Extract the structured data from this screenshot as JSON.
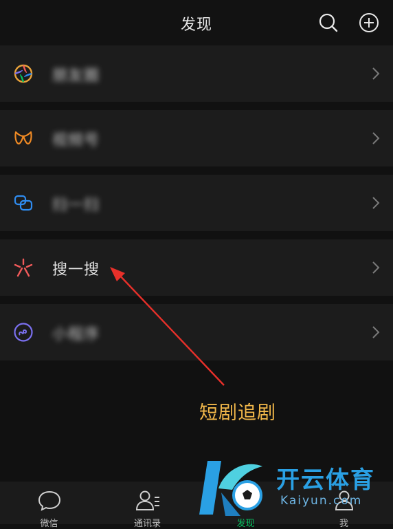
{
  "header": {
    "title": "发现",
    "search_icon": "search-icon",
    "add_icon": "plus-circle-icon"
  },
  "menu": [
    {
      "label": "朋友圈",
      "icon": "moments-aperture-icon",
      "color": "#e9a23b",
      "blurred": true
    },
    {
      "label": "视频号",
      "icon": "channels-icon",
      "color": "#f08a24",
      "blurred": true
    },
    {
      "label": "扫一扫",
      "icon": "scan-icon",
      "color": "#2f8cf0",
      "blurred": true
    },
    {
      "label": "搜一搜",
      "icon": "search-star-icon",
      "color": "#f05a5a",
      "blurred": false
    },
    {
      "label": "小程序",
      "icon": "mini-program-icon",
      "color": "#7b70f0",
      "blurred": true
    }
  ],
  "annotation": {
    "text": "短剧追剧",
    "color": "#f2b84a",
    "arrow_color": "#e8302a"
  },
  "tabbar": {
    "tabs": [
      {
        "label": "微信",
        "icon": "chat-icon",
        "active": false
      },
      {
        "label": "通讯录",
        "icon": "contacts-icon",
        "active": false
      },
      {
        "label": "发现",
        "icon": "compass-icon",
        "active": true
      },
      {
        "label": "我",
        "icon": "profile-icon",
        "active": false
      }
    ]
  },
  "watermark": {
    "title": "开云体育",
    "subtitle": "Kaiyun.com"
  }
}
